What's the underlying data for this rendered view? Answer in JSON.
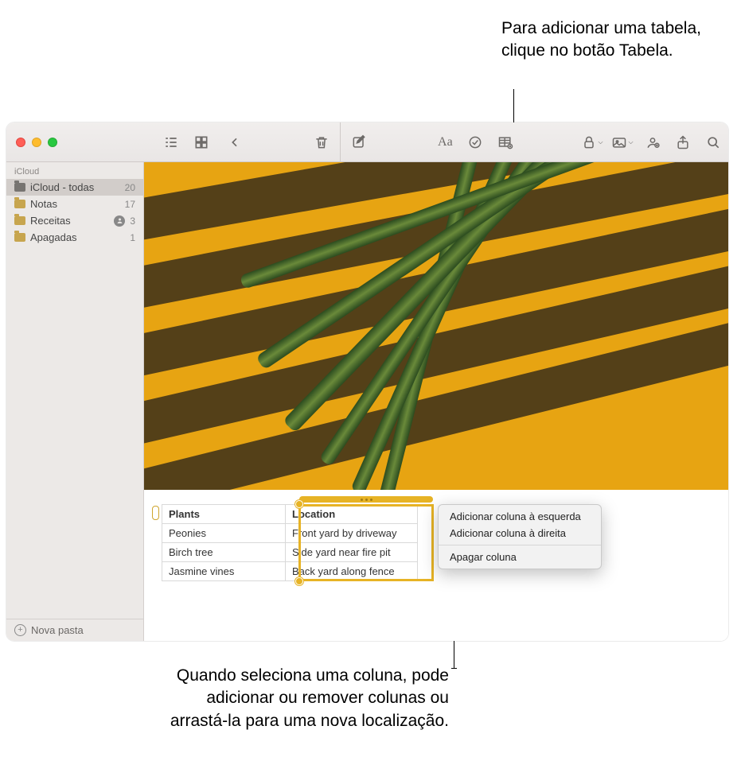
{
  "callouts": {
    "top": "Para adicionar uma tabela, clique no botão Tabela.",
    "bottom": "Quando seleciona uma coluna, pode adicionar ou remover colunas ou arrastá-la para uma nova localização."
  },
  "sidebar": {
    "header": "iCloud",
    "items": [
      {
        "label": "iCloud - todas",
        "count": "20",
        "shared": false,
        "selected": true
      },
      {
        "label": "Notas",
        "count": "17",
        "shared": false,
        "selected": false
      },
      {
        "label": "Receitas",
        "count": "3",
        "shared": true,
        "selected": false
      },
      {
        "label": "Apagadas",
        "count": "1",
        "shared": false,
        "selected": false
      }
    ],
    "new_folder": "Nova pasta"
  },
  "table": {
    "headers": [
      "Plants",
      "Location"
    ],
    "rows": [
      [
        "Peonies",
        "Front yard by driveway"
      ],
      [
        "Birch tree",
        "Side yard near fire pit"
      ],
      [
        "Jasmine vines",
        "Back yard along fence"
      ]
    ]
  },
  "menu": {
    "add_left": "Adicionar coluna à esquerda",
    "add_right": "Adicionar coluna à direita",
    "delete": "Apagar coluna"
  },
  "toolbar": {
    "list_view": "list-view",
    "grid_view": "grid-view",
    "back": "back",
    "trash": "trash",
    "compose": "compose",
    "format": "format",
    "checklist": "checklist",
    "table": "table",
    "lock": "lock",
    "media": "media",
    "collaborate": "collaborate",
    "share": "share",
    "search": "search"
  }
}
